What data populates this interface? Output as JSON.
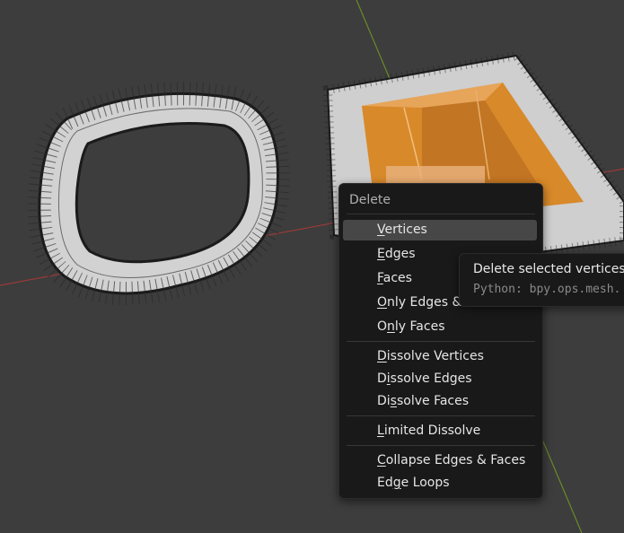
{
  "viewport": {
    "background": "#3d3d3d",
    "axis_colors": {
      "x_axis": "#9a3a3a",
      "y_axis": "#6a8a28"
    },
    "selection_color": "#e8952f",
    "objects": [
      "torus-mesh",
      "cube-frame-mesh"
    ]
  },
  "menu": {
    "title": "Delete",
    "groups": [
      [
        {
          "label": "Vertices",
          "hotkey": "V",
          "highlighted": true
        },
        {
          "label": "Edges",
          "hotkey": "E"
        },
        {
          "label": "Faces",
          "hotkey": "F"
        },
        {
          "label": "Only Edges & Faces",
          "hotkey": "O"
        },
        {
          "label": "Only Faces",
          "hotkey": "n"
        }
      ],
      [
        {
          "label": "Dissolve Vertices",
          "hotkey": "D"
        },
        {
          "label": "Dissolve Edges",
          "hotkey": "i"
        },
        {
          "label": "Dissolve Faces",
          "hotkey": "s"
        }
      ],
      [
        {
          "label": "Limited Dissolve",
          "hotkey": "L"
        }
      ],
      [
        {
          "label": "Collapse Edges & Faces",
          "hotkey": "C"
        },
        {
          "label": "Edge Loops",
          "hotkey": "g"
        }
      ]
    ]
  },
  "tooltip": {
    "description": "Delete selected vertices, e",
    "python": "Python: bpy.ops.mesh."
  }
}
